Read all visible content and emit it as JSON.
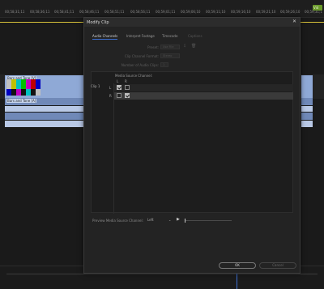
{
  "timeline": {
    "timecodes": [
      "00;58;31;11",
      "00;58;36;11",
      "00;58;41;11",
      "00;58;46;11",
      "00;58;51;11",
      "00;58;56;11",
      "00;59;01;11",
      "00;59;06;10",
      "00;59;11;10",
      "00;59;16;10",
      "00;59;21;10",
      "00;59;26;10",
      "00;59;31;1"
    ],
    "playhead_label": "Vid",
    "clip_label": "Bars and Tone [V]",
    "audio_clip_label": "Bars and Tone [A]",
    "colors": {
      "clip": "#8fa9d6",
      "playhead_line": "#d8c23a",
      "accent": "#3d6fd1"
    }
  },
  "dialog": {
    "title": "Modify Clip",
    "close_icon": "close-icon",
    "tabs": [
      {
        "label": "Audio Channels",
        "state": "active"
      },
      {
        "label": "Interpret Footage",
        "state": "normal"
      },
      {
        "label": "Timecode",
        "state": "normal"
      },
      {
        "label": "Captions",
        "state": "disabled"
      }
    ],
    "form": {
      "preset_label": "Preset:",
      "preset_value": "Use File",
      "format_label": "Clip Channel Format:",
      "format_value": "Stereo",
      "count_label": "Number of Audio Clips:",
      "count_value": "1"
    },
    "channels": {
      "header": "Media Source Channel:",
      "col_left": "L",
      "col_right": "R",
      "clip_label": "Clip 1",
      "rows": [
        {
          "label": "L",
          "left_checked": true,
          "right_checked": false
        },
        {
          "label": "R",
          "left_checked": false,
          "right_checked": true
        }
      ]
    },
    "preview": {
      "label": "Preview Media Source Channel:",
      "value": "Left",
      "play_icon": "play-icon"
    },
    "buttons": {
      "ok": "OK",
      "cancel": "Cancel"
    }
  }
}
